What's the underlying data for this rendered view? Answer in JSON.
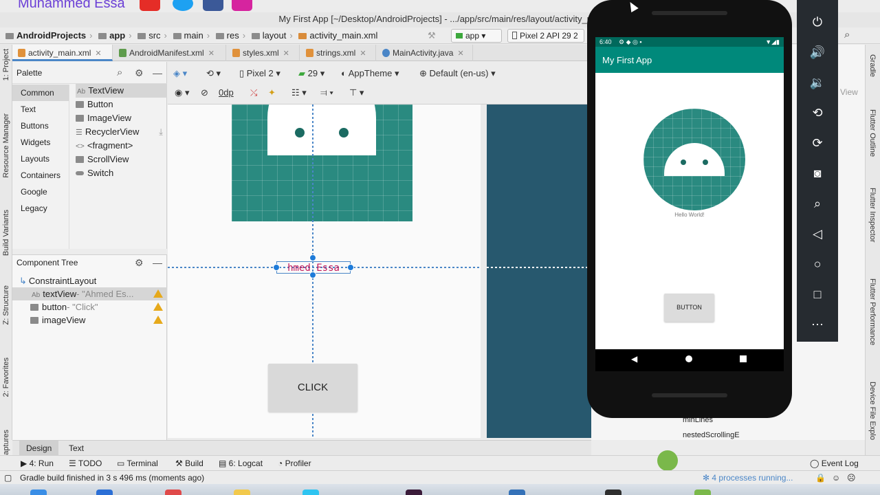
{
  "branding": {
    "name": "Muhammed Essa"
  },
  "window": {
    "title": "My First App [~/Desktop/AndroidProjects] - .../app/src/main/res/layout/activity_mai"
  },
  "breadcrumb": [
    "AndroidProjects",
    "app",
    "src",
    "main",
    "res",
    "layout",
    "activity_main.xml"
  ],
  "run_config": {
    "module": "app",
    "device": "Pixel 2 API 29 2"
  },
  "editor_tabs": [
    {
      "label": "activity_main.xml",
      "active": true
    },
    {
      "label": "AndroidManifest.xml",
      "active": false
    },
    {
      "label": "styles.xml",
      "active": false
    },
    {
      "label": "strings.xml",
      "active": false
    },
    {
      "label": "MainActivity.java",
      "active": false
    }
  ],
  "left_strip": {
    "project": "1: Project",
    "resource_manager": "Resource Manager",
    "build_variants": "Build Variants",
    "structure": "Z: Structure",
    "favorites": "2: Favorites",
    "captures": "aptures"
  },
  "palette": {
    "title": "Palette",
    "categories": [
      "Common",
      "Text",
      "Buttons",
      "Widgets",
      "Layouts",
      "Containers",
      "Google",
      "Legacy"
    ],
    "selected_category": "Common",
    "items": [
      "TextView",
      "Button",
      "ImageView",
      "RecyclerView",
      "<fragment>",
      "ScrollView",
      "Switch"
    ],
    "item_prefix": "Ab"
  },
  "component_tree": {
    "title": "Component Tree",
    "root": "ConstraintLayout",
    "nodes": [
      {
        "name": "textView",
        "detail": "- \"Ahmed Es...",
        "prefix": "Ab"
      },
      {
        "name": "button",
        "detail": "- \"Click\""
      },
      {
        "name": "imageView",
        "detail": ""
      }
    ]
  },
  "design_toolbar": {
    "device": "Pixel 2",
    "api": "29",
    "theme": "AppTheme",
    "locale": "Default (en-us)",
    "margin": "0dp"
  },
  "canvas": {
    "text_view": "hmed Essa",
    "button": "CLICK"
  },
  "view_tabs": {
    "design": "Design",
    "text": "Text",
    "selected": "Design"
  },
  "attributes": {
    "attr1": "minLines",
    "attr2": "nestedScrollingE",
    "view_label": "View"
  },
  "right_strip": {
    "gradle": "Gradle",
    "outline": "Flutter Outline",
    "inspector": "Flutter Inspector",
    "performance": "Flutter Performance",
    "explorer": "Device File Explo"
  },
  "tool_windows": [
    {
      "label": "4: Run",
      "icon": "play-icon"
    },
    {
      "label": "TODO",
      "icon": "list-icon"
    },
    {
      "label": "Terminal",
      "icon": "terminal-icon"
    },
    {
      "label": "Build",
      "icon": "hammer-icon"
    },
    {
      "label": "6: Logcat",
      "icon": "logcat-icon"
    },
    {
      "label": "Profiler",
      "icon": "profiler-icon"
    }
  ],
  "event_log": "Event Log",
  "status": {
    "message": "Gradle build finished in 3 s 496 ms (moments ago)",
    "processes": "4 processes running..."
  },
  "emulator": {
    "time": "6:40",
    "app_title": "My First App",
    "hello": "Hello World!",
    "button": "BUTTON",
    "controls": [
      "power-icon",
      "volume-up-icon",
      "volume-down-icon",
      "rotate-left-icon",
      "rotate-right-icon",
      "camera-icon",
      "zoom-icon",
      "back-icon",
      "home-icon",
      "overview-icon",
      "more-icon"
    ]
  },
  "colors": {
    "teal_dark": "#00695c",
    "teal": "#00897b",
    "accent": "#4a86c7",
    "text_pink": "#c2185b",
    "blueprint": "#27586e"
  }
}
